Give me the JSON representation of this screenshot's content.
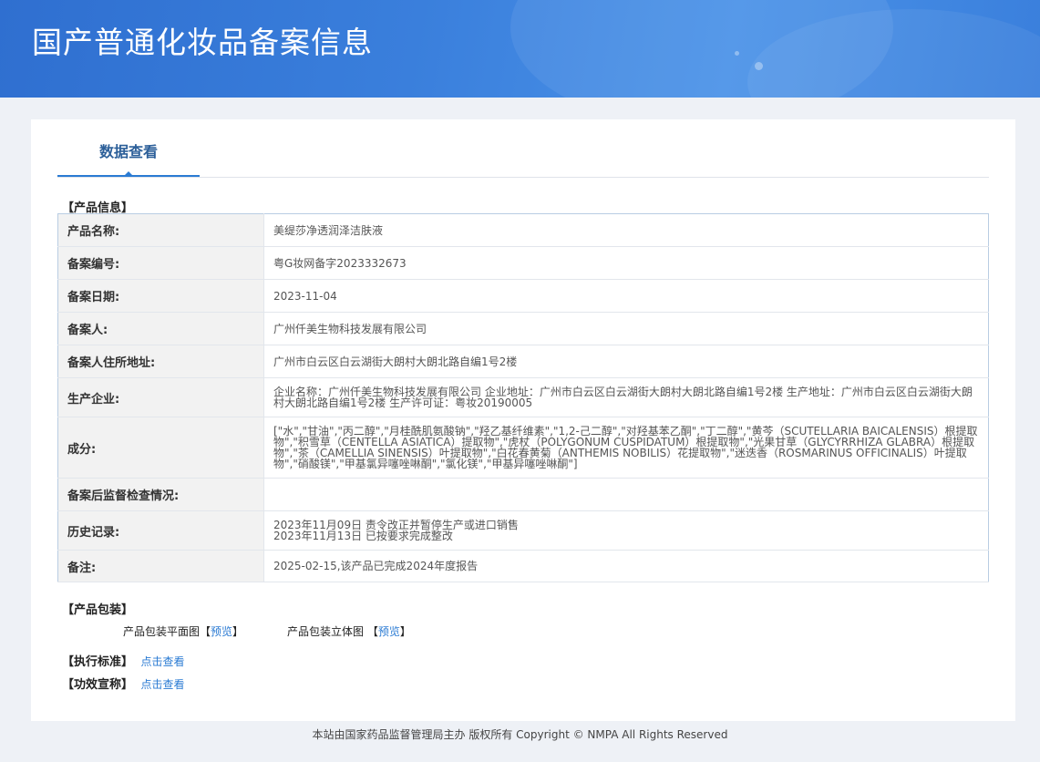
{
  "header": {
    "title": "国产普通化妆品备案信息"
  },
  "tabs": [
    {
      "label": "数据查看"
    }
  ],
  "product_info": {
    "section_title": "【产品信息】",
    "rows": [
      {
        "label": "产品名称:",
        "value": "美缇莎净透润泽洁肤液"
      },
      {
        "label": "备案编号:",
        "value": "粤G妆网备字2023332673"
      },
      {
        "label": "备案日期:",
        "value": "2023-11-04"
      },
      {
        "label": "备案人:",
        "value": "广州仟美生物科技发展有限公司"
      },
      {
        "label": "备案人住所地址:",
        "value": "广州市白云区白云湖街大朗村大朗北路自编1号2楼"
      },
      {
        "label": "生产企业:",
        "value": "企业名称：广州仟美生物科技发展有限公司 企业地址：广州市白云区白云湖街大朗村大朗北路自编1号2楼 生产地址：广州市白云区白云湖街大朗村大朗北路自编1号2楼 生产许可证：粤妆20190005"
      },
      {
        "label": "成分:",
        "value": "[\"水\",\"甘油\",\"丙二醇\",\"月桂酰肌氨酸钠\",\"羟乙基纤维素\",\"1,2-己二醇\",\"对羟基苯乙酮\",\"丁二醇\",\"黄芩（SCUTELLARIA BAICALENSIS）根提取物\",\"积雪草（CENTELLA ASIATICA）提取物\",\"虎杖（POLYGONUM CUSPIDATUM）根提取物\",\"光果甘草（GLYCYRRHIZA GLABRA）根提取物\",\"茶（CAMELLIA SINENSIS）叶提取物\",\"白花春黄菊（ANTHEMIS NOBILIS）花提取物\",\"迷迭香（ROSMARINUS OFFICINALIS）叶提取物\",\"硝酸镁\",\"甲基氯异噻唑啉酮\",\"氯化镁\",\"甲基异噻唑啉酮\"]"
      },
      {
        "label": "备案后监督检查情况:",
        "value": ""
      },
      {
        "label": "历史记录:",
        "value": "2023年11月09日 责令改正并暂停生产或进口销售",
        "value2": "2023年11月13日 已按要求完成整改"
      },
      {
        "label": "备注:",
        "value": "2025-02-15,该产品已完成2024年度报告"
      }
    ]
  },
  "packaging": {
    "section_title": "【产品包装】",
    "flat_label": "产品包装平面图",
    "flat_link": "预览",
    "solid_label": "产品包装立体图",
    "solid_link": "预览"
  },
  "standard": {
    "section_title": "【执行标准】",
    "link": "点击查看"
  },
  "efficacy": {
    "section_title": "【功效宣称】",
    "link": "点击查看"
  },
  "footer": {
    "text": "本站由国家药品监督管理局主办 版权所有 Copyright © NMPA All Rights Reserved"
  }
}
